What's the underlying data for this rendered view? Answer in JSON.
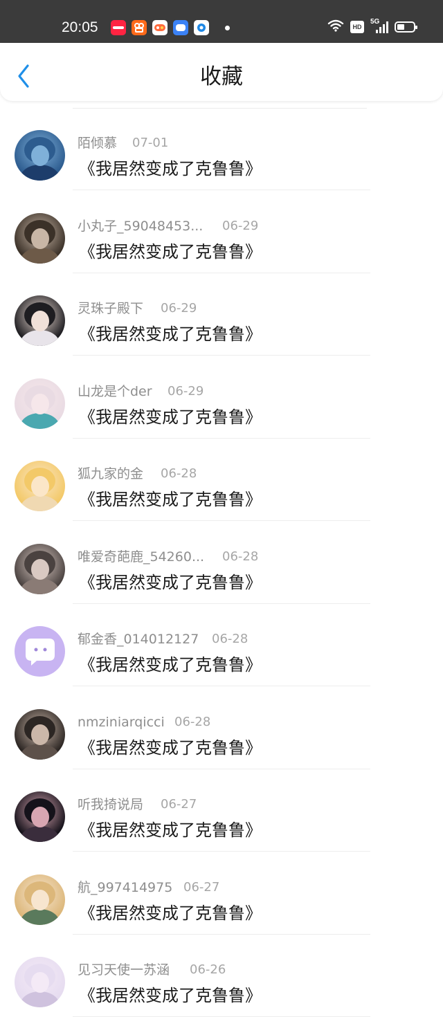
{
  "status_bar": {
    "time": "20:05",
    "app_icons": [
      "xiaohongshu-app-icon",
      "kuaishou-app-icon",
      "game-center-app-icon",
      "weibo-app-icon",
      "browser-app-icon"
    ],
    "network": "5G",
    "hd_badge": "HD"
  },
  "header": {
    "title": "收藏",
    "back_icon": "chevron-left-icon",
    "accent_color": "#1f8fe8"
  },
  "items": [
    {
      "user": "陌倾慕",
      "date": "07-01",
      "title": "《我居然变成了克鲁鲁》",
      "avatar_colors": [
        "#2d5c8f",
        "#7fb0d9",
        "#1d3d6b"
      ]
    },
    {
      "user": "小丸子_59048453...",
      "date": "06-29",
      "title": "《我居然变成了克鲁鲁》",
      "avatar_colors": [
        "#3b3128",
        "#c8b6a6",
        "#6d5a48"
      ]
    },
    {
      "user": "灵珠子殿下",
      "date": "06-29",
      "title": "《我居然变成了克鲁鲁》",
      "avatar_colors": [
        "#1e1d21",
        "#f0e0d8",
        "#e8e4ea"
      ]
    },
    {
      "user": "山龙是个der",
      "date": "06-29",
      "title": "《我居然变成了克鲁鲁》",
      "avatar_colors": [
        "#e9dbe3",
        "#f6e7ea",
        "#4aa8b0"
      ]
    },
    {
      "user": "狐九家的金",
      "date": "06-28",
      "title": "《我居然变成了克鲁鲁》",
      "avatar_colors": [
        "#f3c968",
        "#fbe6c8",
        "#f0d9b2"
      ]
    },
    {
      "user": "唯爱奇葩鹿_54260...",
      "date": "06-28",
      "title": "《我居然变成了克鲁鲁》",
      "avatar_colors": [
        "#4a4240",
        "#d9c9c2",
        "#8a7b75"
      ]
    },
    {
      "user": "郁金香_014012127",
      "date": "06-28",
      "title": "《我居然变成了克鲁鲁》",
      "avatar_colors": [
        "#c8b4f2",
        "#ffffff",
        "#c8b4f2"
      ]
    },
    {
      "user": "nmziniarqicci",
      "date": "06-28",
      "title": "《我居然变成了克鲁鲁》",
      "avatar_colors": [
        "#2c2623",
        "#cbb7a9",
        "#5d514a"
      ]
    },
    {
      "user": "听我掎说局",
      "date": "06-27",
      "title": "《我居然变成了克鲁鲁》",
      "avatar_colors": [
        "#15121a",
        "#d8a6b2",
        "#3a2d3c"
      ]
    },
    {
      "user": "航_997414975",
      "date": "06-27",
      "title": "《我居然变成了克鲁鲁》",
      "avatar_colors": [
        "#dcb77a",
        "#f7e5cf",
        "#5a7a5c"
      ]
    },
    {
      "user": "见习天使一苏涵",
      "date": "06-26",
      "title": "《我居然变成了克鲁鲁》",
      "avatar_colors": [
        "#e6dcf0",
        "#f4eaf6",
        "#cfc2de"
      ]
    }
  ]
}
